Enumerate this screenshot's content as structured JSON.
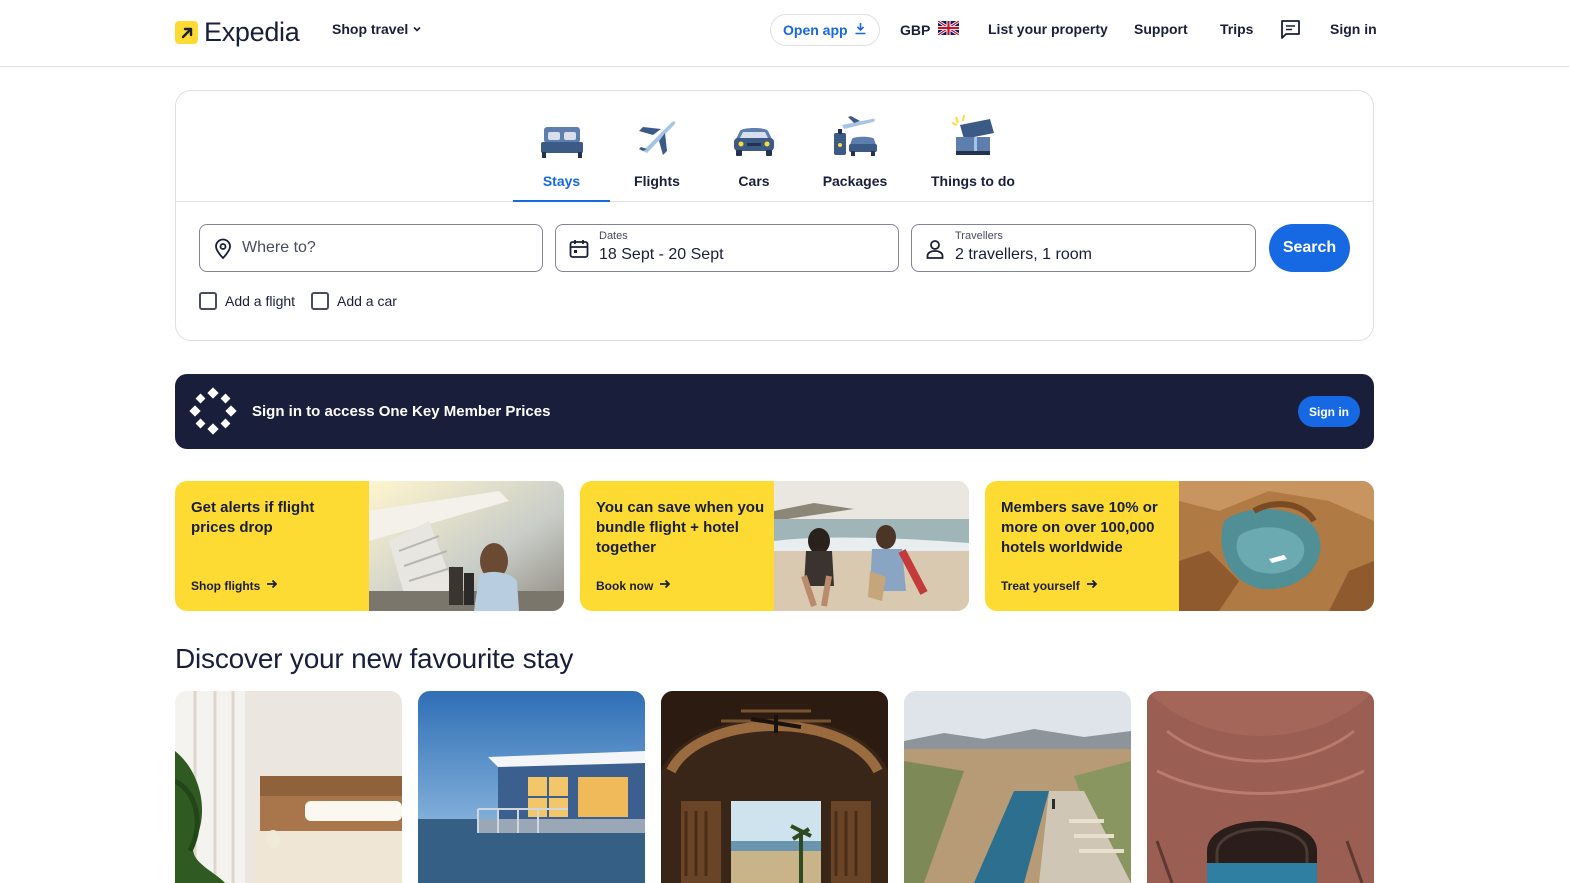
{
  "header": {
    "brand": "Expedia",
    "shop_travel": "Shop travel",
    "open_app": "Open app",
    "currency": "GBP",
    "list_property": "List your property",
    "support": "Support",
    "trips": "Trips",
    "sign_in": "Sign in"
  },
  "tabs": [
    {
      "label": "Stays",
      "icon": "bed-icon",
      "active": true
    },
    {
      "label": "Flights",
      "icon": "plane-icon",
      "active": false
    },
    {
      "label": "Cars",
      "icon": "car-icon",
      "active": false
    },
    {
      "label": "Packages",
      "icon": "packages-icon",
      "active": false
    },
    {
      "label": "Things to do",
      "icon": "ticket-icon",
      "active": false
    }
  ],
  "search": {
    "destination_placeholder": "Where to?",
    "dates_label": "Dates",
    "dates_value": "18 Sept - 20 Sept",
    "travellers_label": "Travellers",
    "travellers_value": "2 travellers, 1 room",
    "search_button": "Search",
    "add_flight": "Add a flight",
    "add_car": "Add a car"
  },
  "banner": {
    "text": "Sign in to access One Key Member Prices",
    "button": "Sign in"
  },
  "promos": [
    {
      "text": "Get alerts if flight prices drop",
      "link": "Shop flights"
    },
    {
      "text": "You can save when you bundle flight + hotel together",
      "link": "Book now"
    },
    {
      "text": "Members save 10% or more on over 100,000 hotels worldwide",
      "link": "Treat yourself"
    }
  ],
  "section": {
    "title": "Discover your new favourite stay"
  },
  "colors": {
    "brand_yellow": "#fddb32",
    "primary_blue": "#1668e3",
    "navy": "#191e3b"
  }
}
